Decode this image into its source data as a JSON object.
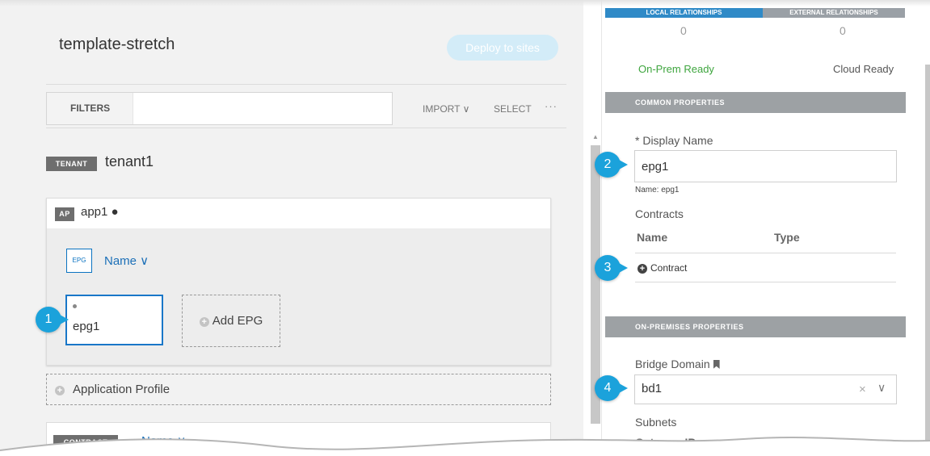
{
  "left": {
    "template_title": "template-stretch",
    "deploy_label": "Deploy to sites",
    "filters_label": "FILTERS",
    "filters_value": "",
    "import_label": "IMPORT ∨",
    "select_label": "SELECT",
    "more_label": "···",
    "tenant_tag": "TENANT",
    "tenant_name": "tenant1",
    "ap_tag": "AP",
    "ap_name": "app1 ●",
    "epg_tag": "EPG",
    "epg_sort": "Name ∨",
    "epg_name": "epg1",
    "add_epg": "Add EPG",
    "application_profile": "Application Profile",
    "contract_tag": "CONTRACT",
    "contract_sort": "Name ∨"
  },
  "right": {
    "tabs": [
      {
        "label": "LOCAL RELATIONSHIPS",
        "count": "0"
      },
      {
        "label": "EXTERNAL RELATIONSHIPS",
        "count": "0"
      }
    ],
    "on_prem_ready": "On-Prem Ready",
    "cloud_ready": "Cloud Ready",
    "common_properties": "COMMON PROPERTIES",
    "display_name_label": "* Display Name",
    "display_name_value": "epg1",
    "name_note": "Name: epg1",
    "contracts_label": "Contracts",
    "contracts_col_name": "Name",
    "contracts_col_type": "Type",
    "add_contract": "Contract",
    "on_premises_properties": "ON-PREMISES PROPERTIES",
    "bridge_domain_label": "Bridge Domain",
    "bridge_domain_value": "bd1",
    "subnets_label": "Subnets",
    "gateway_ip_label": "Gateway IP"
  },
  "callouts": [
    "1",
    "2",
    "3",
    "4"
  ],
  "colors": {
    "accent": "#1ba2db",
    "link": "#1b6fb8",
    "ready_green": "#3ea53e",
    "section_gray": "#9da1a4"
  }
}
